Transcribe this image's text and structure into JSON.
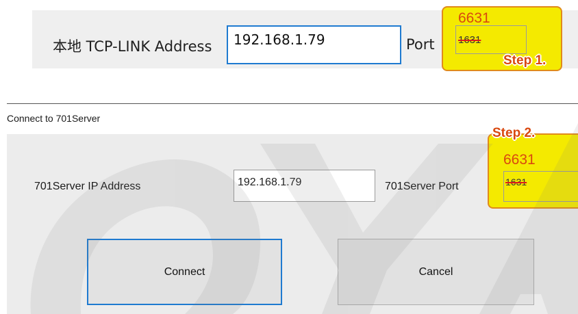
{
  "top_panel": {
    "address_label": "本地 TCP-LINK Address",
    "ip_value": "192.168.1.79",
    "port_label": "Port",
    "new_port": "6631",
    "old_port": "1631",
    "step_label": "Step 1."
  },
  "dialog": {
    "title": "Connect to 701Server",
    "ip_label": "701Server IP Address",
    "ip_value": "192.168.1.79",
    "port_label": "701Server Port",
    "new_port": "6631",
    "old_port": "1631",
    "step_label": "Step 2.",
    "connect_label": "Connect",
    "cancel_label": "Cancel"
  },
  "watermark": "OYA",
  "colors": {
    "highlight": "#f4ea00",
    "highlight_border": "#e08a1c",
    "step_text": "#d9480f",
    "focus_blue": "#1e7ad0"
  }
}
